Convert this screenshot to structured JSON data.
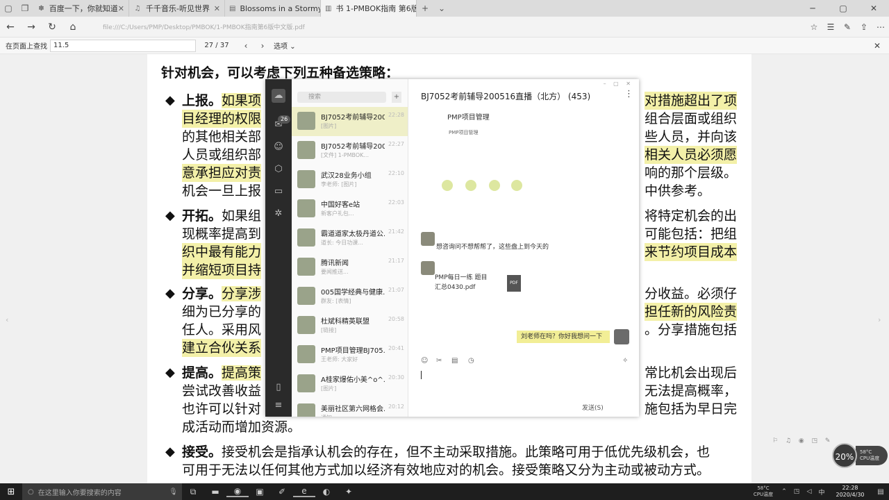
{
  "browser": {
    "tabs": [
      {
        "label": "百度一下，你就知道",
        "icon": "paw-icon"
      },
      {
        "label": "千千音乐-听见世界",
        "icon": "music-icon"
      },
      {
        "label": "Blossoms in a Stormy Night",
        "icon": "doc-icon"
      },
      {
        "label": "书 1-PMBOK指南 第6版",
        "icon": "pdf-icon",
        "active": true
      }
    ],
    "new_tab": "+",
    "url": "file:///C:/Users/PMP/Desktop/PMBOK/1-PMBOK指南第6版中文版.pdf"
  },
  "findbar": {
    "label": "在页面上查找",
    "query": "11.5",
    "count": "27 / 37",
    "options_label": "选项",
    "chevron": "⌄"
  },
  "document": {
    "intro": "针对机会，可以考虑下列五种备选策略：",
    "left_lines": [
      {
        "head": "上报。",
        "text": "如果项"
      },
      {
        "text": "目经理的权限"
      },
      {
        "text": "的其他相关部"
      },
      {
        "text": "人员或组织部"
      },
      {
        "text": "意承担应对责"
      },
      {
        "text": "机会一旦上报"
      },
      {
        "head": "开拓。",
        "text": "如果组"
      },
      {
        "text": "现概率提高到"
      },
      {
        "text": "织中最有能力"
      },
      {
        "text": "并缩短项目持"
      },
      {
        "head": "分享。",
        "text": "分享涉"
      },
      {
        "text": "细为已分享的"
      },
      {
        "text": "任人。采用风"
      },
      {
        "text": "建立合伙关系"
      },
      {
        "head": "提高。",
        "text": "提高策"
      },
      {
        "text": "尝试改善收益"
      },
      {
        "text": "也许可以针对"
      },
      {
        "text": "成活动而增加资源。"
      },
      {
        "head": "接受。",
        "text": "接受机会是指承认机会的存在，但不主动采取措施。此策略可用于低优先级机会，也"
      },
      {
        "text": "可用于无法以任何其他方式加以经济有效地应对的机会。接受策略又分为主动或被动方式。"
      }
    ],
    "right_lines": [
      "对措施超出了项",
      "组合层面或组织",
      "些人员，并向该",
      "相关人员必须愿",
      "响的那个层级。",
      "中供参考。",
      "将特定机会的出",
      "可能包括：把组",
      "来节约项目成本",
      "分收益。必须仔",
      "担任新的风险责",
      "。分享措施包括",
      "常比机会出现后",
      "无法提高概率，",
      "施包括为早日完"
    ]
  },
  "qq": {
    "search_placeholder": "搜索",
    "plus": "+",
    "badge": "26",
    "conversations": [
      {
        "name": "BJ7052考前辅导200...",
        "time": "22:28",
        "preview": "[图片]",
        "selected": true
      },
      {
        "name": "BJ7052考前辅导200...",
        "time": "22:27",
        "preview": "[文件] 1-PMBOK..."
      },
      {
        "name": "武汉28业务小组",
        "time": "22:10",
        "preview": "李老师: [图片]"
      },
      {
        "name": "中国好客e站",
        "time": "22:03",
        "preview": "新客户礼包..."
      },
      {
        "name": "霸道道家太极丹道公...",
        "time": "21:42",
        "preview": "道长: 今日功课..."
      },
      {
        "name": "腾讯新闻",
        "time": "21:17",
        "preview": "要闻推送..."
      },
      {
        "name": "005国学经典与健康...",
        "time": "21:07",
        "preview": "群友: [表情]"
      },
      {
        "name": "杜斌科精英联盟",
        "time": "20:58",
        "preview": "[链接]"
      },
      {
        "name": "PMP项目管理BJ705...",
        "time": "20:41",
        "preview": "王老师: 大家好"
      },
      {
        "name": "A桂家爆佑小美^o^...",
        "time": "20:30",
        "preview": "[图片]"
      },
      {
        "name": "美丽社区第六网格会...",
        "time": "20:12",
        "preview": "通知..."
      }
    ],
    "chat_title": "BJ7052考前辅导200516直播（北方） (453)",
    "more": "⋮",
    "card_title": "PMP项目管理",
    "card_sub": "PMP项目管理",
    "msg1_text": "想咨询问不想帮帮了，这些盘上到今天的",
    "file_name_1": "PMP每日一练 题目",
    "file_name_2": "汇总0430.pdf",
    "pdf_label": "PDF",
    "out_bubble": "刘老师在吗？你好我想问一下",
    "send_label": "发送(S)"
  },
  "widget": {
    "percent": "20%",
    "temp": "58°C",
    "cpu": "CPU温度"
  },
  "taskbar": {
    "search_placeholder": "在这里输入你要搜索的内容",
    "temp_line1": "58°C",
    "temp_line2": "CPU温度",
    "time": "22:28",
    "date": "2020/4/30"
  }
}
